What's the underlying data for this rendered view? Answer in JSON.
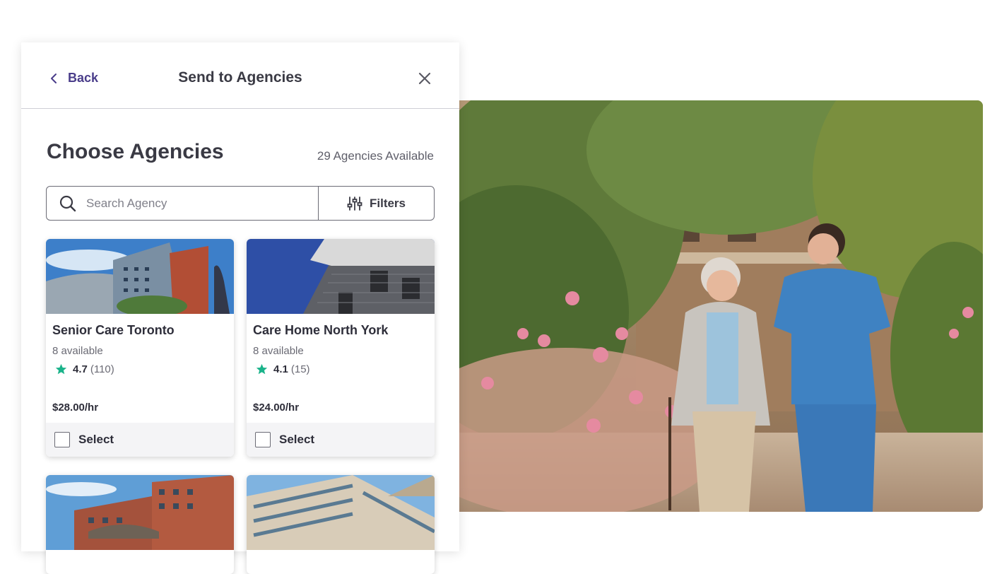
{
  "header": {
    "back_label": "Back",
    "title": "Send to Agencies"
  },
  "section": {
    "title": "Choose Agencies",
    "available_count": "29 Agencies Available"
  },
  "search": {
    "placeholder": "Search Agency",
    "filters_label": "Filters"
  },
  "agencies": [
    {
      "name": "Senior Care Toronto",
      "available": "8 available",
      "rating": "4.7",
      "reviews": "(110)",
      "price": "$28.00/hr",
      "select_label": "Select"
    },
    {
      "name": "Care Home North York",
      "available": "8 available",
      "rating": "4.1",
      "reviews": "(15)",
      "price": "$24.00/hr",
      "select_label": "Select"
    }
  ],
  "colors": {
    "accent": "#4a3d8a",
    "star": "#1ab38a",
    "border": "#6b6b75"
  },
  "icons": [
    "chevron-left-icon",
    "close-icon",
    "search-icon",
    "sliders-icon",
    "star-icon"
  ]
}
